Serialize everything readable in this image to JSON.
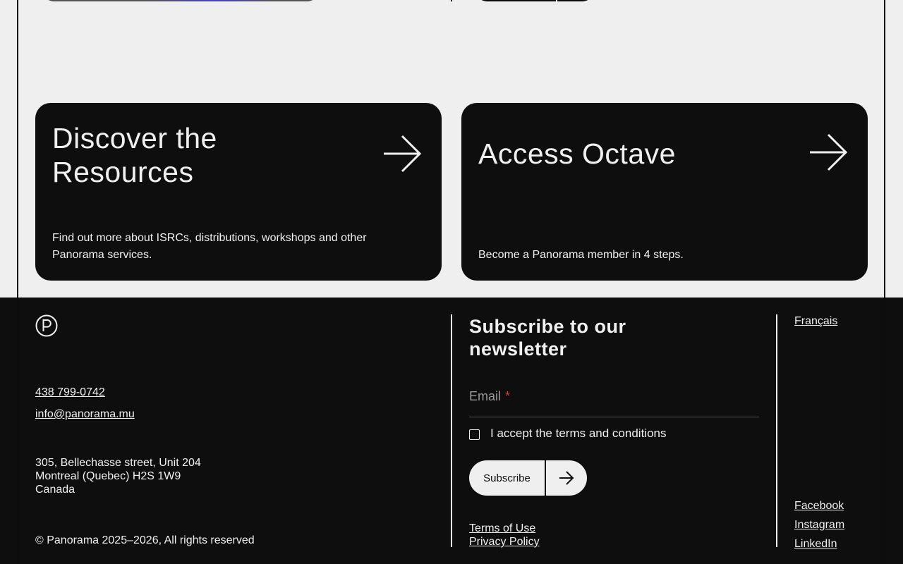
{
  "cards": [
    {
      "title": "Discover the Resources",
      "description": "Find out more about ISRCs, distributions, workshops and other Panorama services.",
      "arrow_icon": "arrow-right-icon"
    },
    {
      "title": "Access Octave",
      "description": "Become a Panorama member in 4 steps.",
      "arrow_icon": "arrow-right-icon"
    }
  ],
  "footer": {
    "logo_icon": "panorama-p-logo-icon",
    "phone": "438 799-0742",
    "email": "info@panorama.mu",
    "address": {
      "line1": "305, Bellechasse street, Unit 204",
      "line2": "Montreal (Quebec) H2S 1W9",
      "line3": "Canada"
    },
    "copyright": "© Panorama 2025–2026, All rights reserved",
    "newsletter": {
      "title": "Subscribe to our newsletter",
      "email_label": "Email",
      "required_mark": "*",
      "terms_label": "I accept the terms and conditions",
      "subscribe_label": "Subscribe"
    },
    "legal": {
      "terms": "Terms of Use",
      "privacy": "Privacy Policy"
    },
    "language": "Français",
    "socials": [
      "Facebook",
      "Instagram",
      "LinkedIn"
    ]
  },
  "colors": {
    "background": "#efefef",
    "dark": "#0e0e0e",
    "text_light": "#f0f0f0",
    "required": "#d23c3c"
  }
}
